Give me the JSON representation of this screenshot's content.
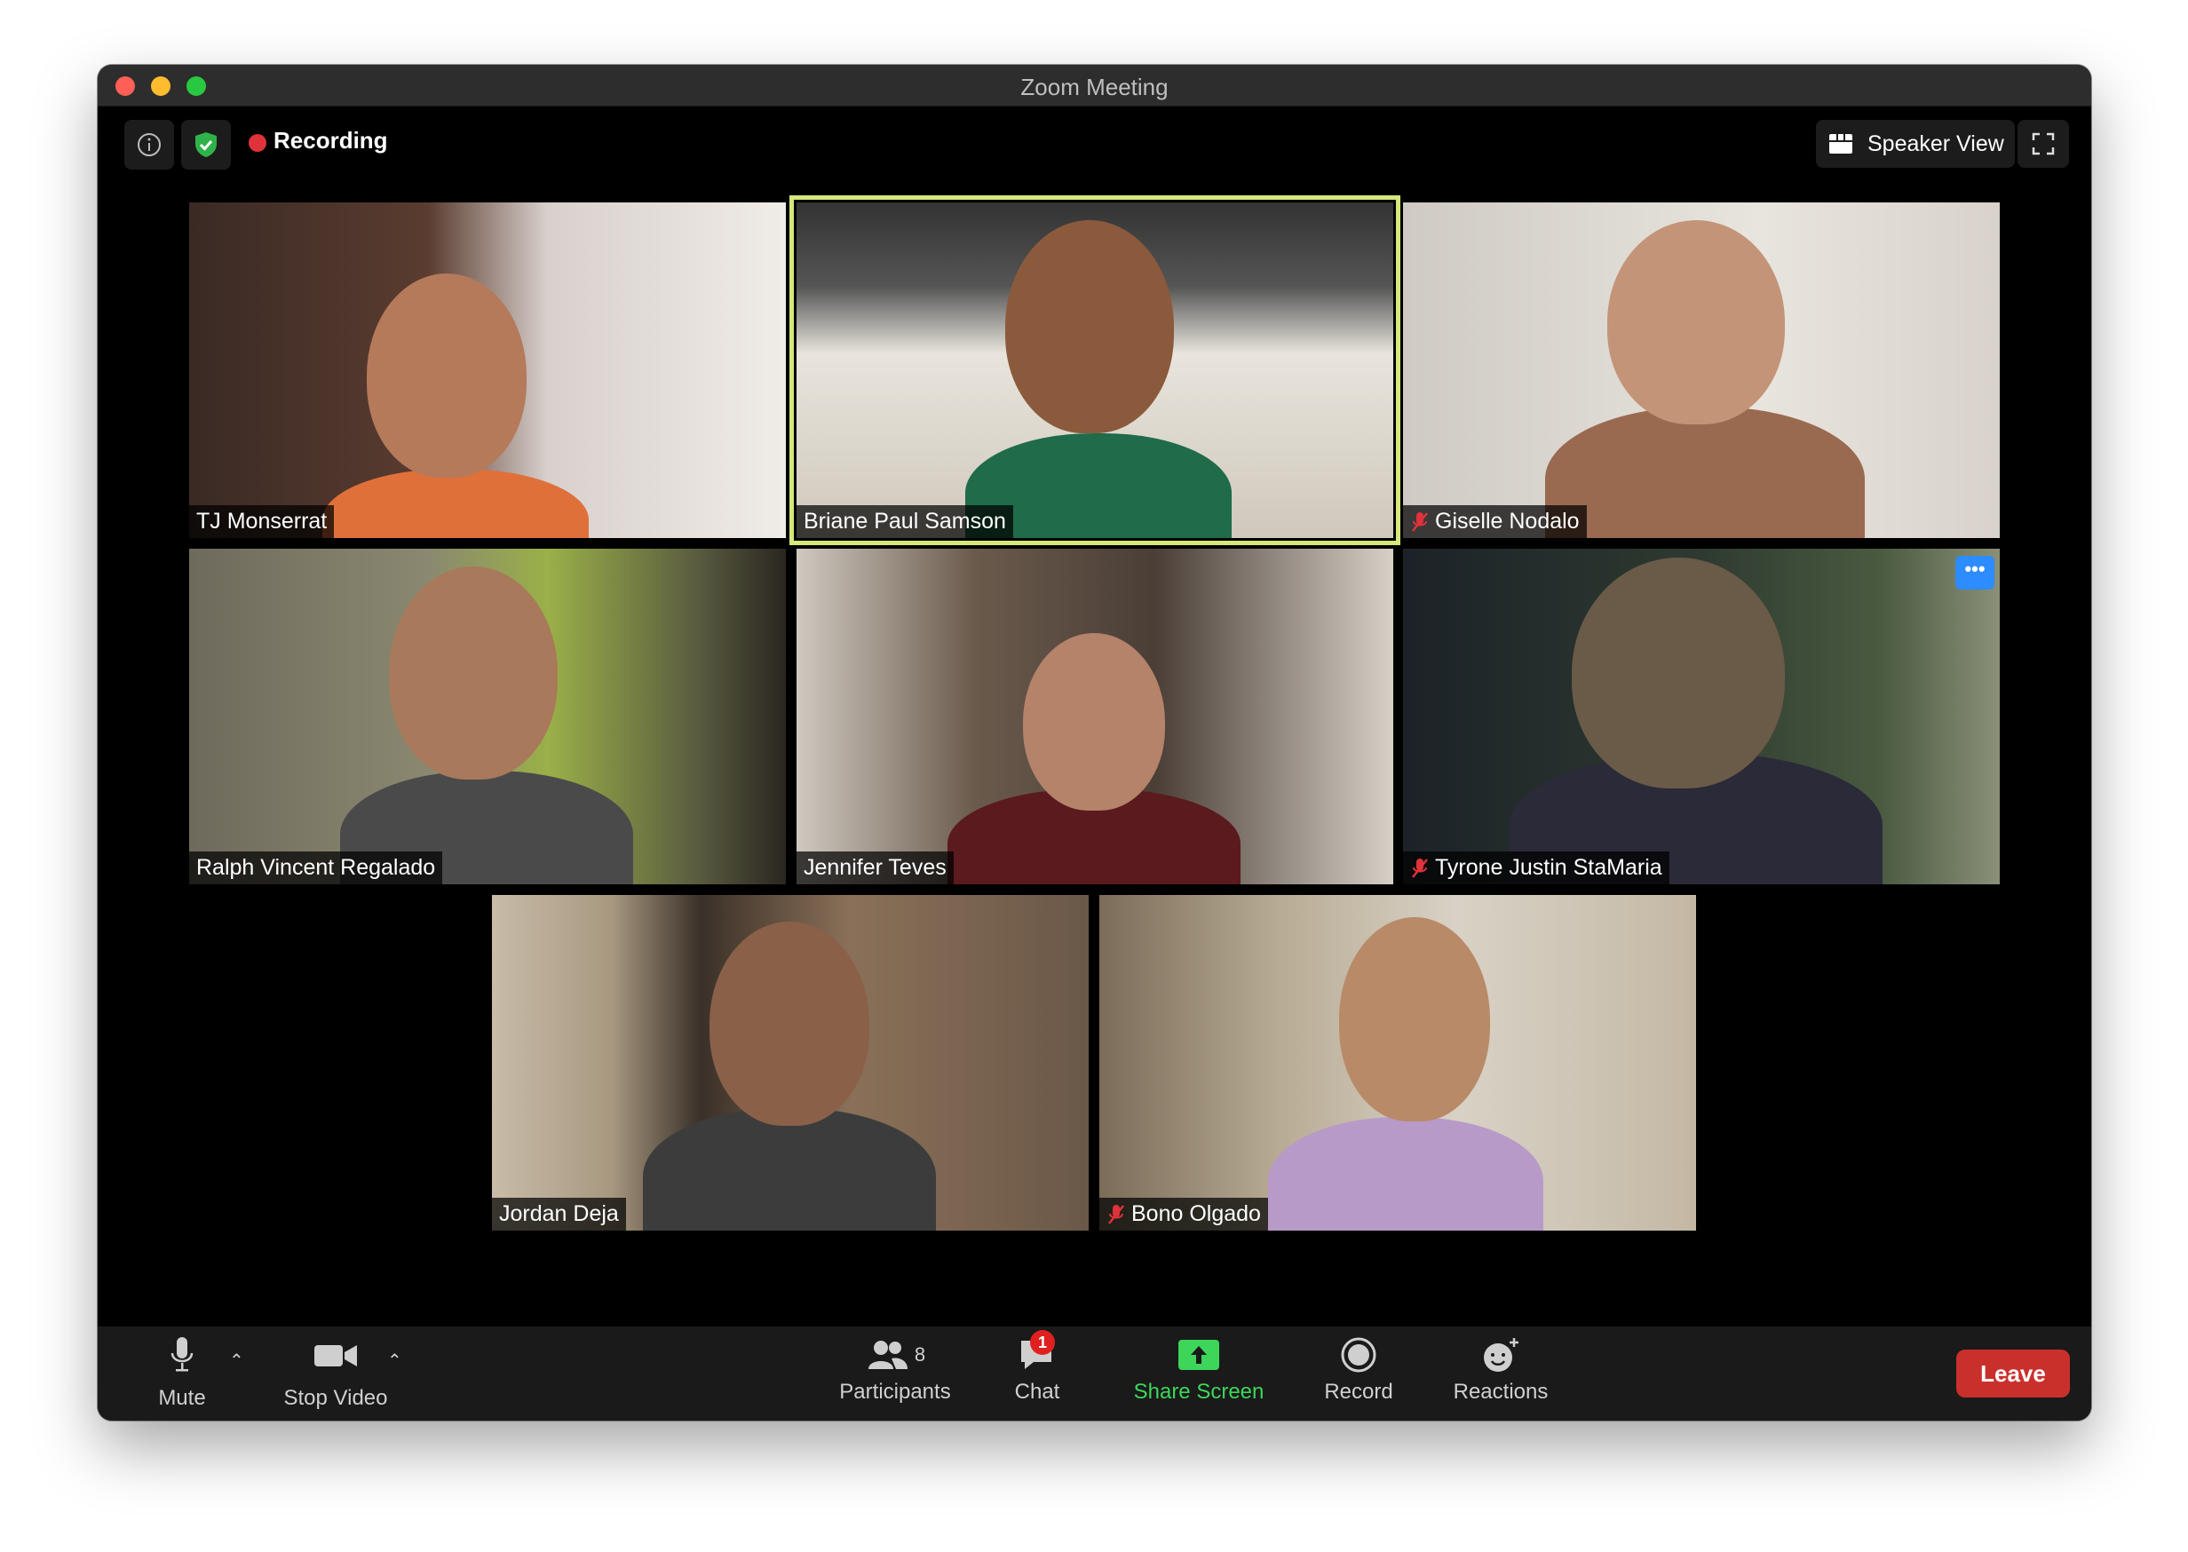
{
  "window": {
    "title": "Zoom Meeting"
  },
  "topbar": {
    "recording_label": "Recording",
    "view_label": "Speaker View"
  },
  "participants": [
    {
      "name": "TJ Monserrat",
      "muted": false,
      "active_speaker": false
    },
    {
      "name": "Briane Paul Samson",
      "muted": false,
      "active_speaker": true
    },
    {
      "name": "Giselle Nodalo",
      "muted": true,
      "active_speaker": false
    },
    {
      "name": "Ralph Vincent Regalado",
      "muted": false,
      "active_speaker": false
    },
    {
      "name": "Jennifer Teves",
      "muted": false,
      "active_speaker": false
    },
    {
      "name": "Tyrone Justin StaMaria",
      "muted": true,
      "active_speaker": false,
      "more_label": "•••"
    },
    {
      "name": "Jordan Deja",
      "muted": false,
      "active_speaker": false
    },
    {
      "name": "Bono Olgado",
      "muted": true,
      "active_speaker": false
    }
  ],
  "toolbar": {
    "mute_label": "Mute",
    "video_label": "Stop Video",
    "participants_label": "Participants",
    "participants_count": "8",
    "chat_label": "Chat",
    "chat_badge": "1",
    "share_label": "Share Screen",
    "record_label": "Record",
    "reactions_label": "Reactions",
    "leave_label": "Leave"
  },
  "colors": {
    "active_speaker_border": "#d6e77b",
    "share_green": "#3dd65a",
    "leave_red": "#c9302c",
    "recording_red": "#e0323a",
    "shield_green": "#2fb24a"
  },
  "icons": [
    "info-icon",
    "shield-check-icon",
    "grid-icon",
    "fullscreen-icon",
    "microphone-icon",
    "video-camera-icon",
    "participants-icon",
    "chat-icon",
    "share-screen-icon",
    "record-icon",
    "reactions-icon",
    "muted-mic-icon"
  ]
}
